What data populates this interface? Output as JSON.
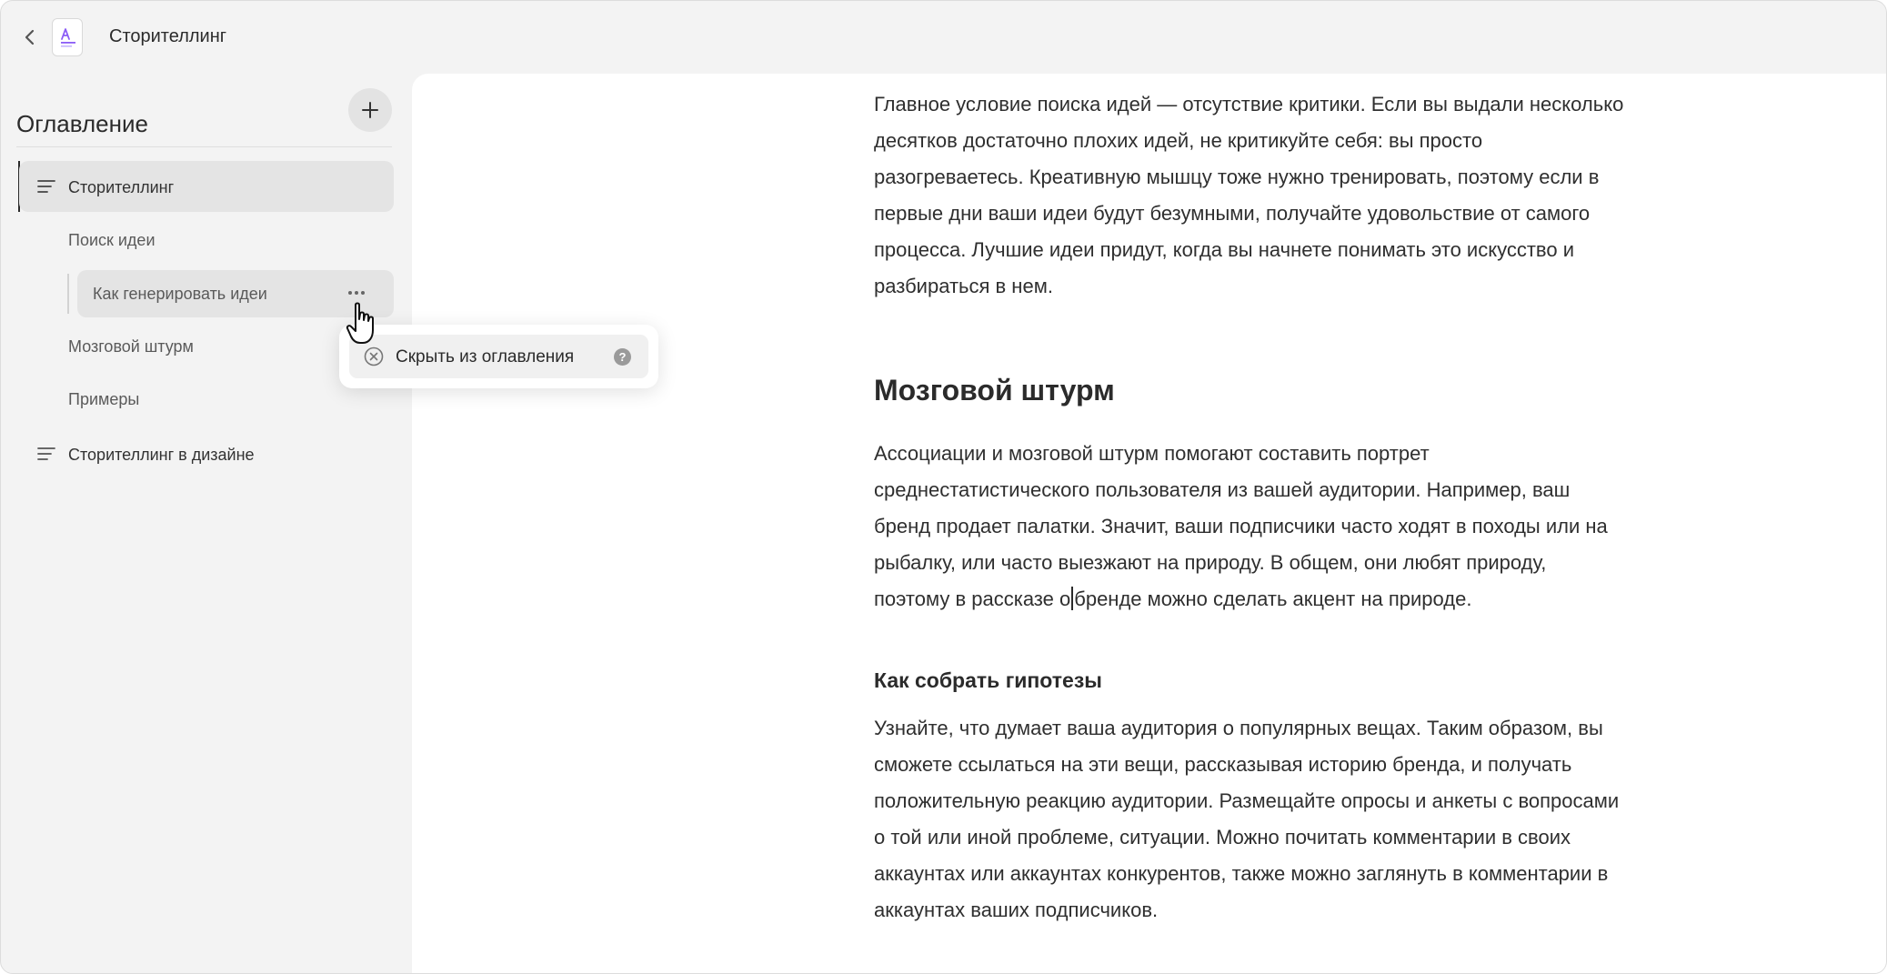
{
  "window": {
    "title": "Сторителлинг"
  },
  "sidebar": {
    "heading": "Оглавление",
    "add_button": "+",
    "items": [
      {
        "label": "Сторителлинг",
        "level": 1,
        "active": true
      },
      {
        "label": "Поиск идеи",
        "level": 2
      },
      {
        "label": "Как генерировать идеи",
        "level": 3,
        "hovered": true
      },
      {
        "label": "Мозговой штурм",
        "level": 2
      },
      {
        "label": "Примеры",
        "level": 2
      },
      {
        "label": "Сторителлинг в дизайне",
        "level": 1
      }
    ]
  },
  "context_menu": {
    "item_label": "Скрыть из оглавления",
    "help_icon": "?"
  },
  "article": {
    "intro_lines": [
      "Главное условие поиска идей — отсутствие критики. Если вы выдали несколько",
      "десятков достаточно плохих идей, не критикуйте себя: вы просто",
      "разогреваетесь. Креативную мышцу тоже нужно тренировать, поэтому если в",
      "первые дни ваши идеи будут безумными, получайте удовольствие от самого",
      "процесса. Лучшие идеи придут, когда вы начнете понимать это искусство и",
      "разбираться в нем."
    ],
    "h2": "Мозговой штурм",
    "brainstorm_lines": [
      "Ассоциации и мозговой штурм помогают составить портрет",
      "среднестатистического пользователя из вашей аудитории. Например, ваш",
      "бренд продает палатки. Значит, ваши подписчики часто ходят в походы или на",
      "рыбалку, или часто выезжают на природу. В общем, они любят природу,"
    ],
    "brainstorm_last_before_caret": "поэтому в рассказе о",
    "brainstorm_last_after_caret": "бренде можно сделать акцент на природе.",
    "h3": "Как собрать гипотезы",
    "hypotheses_lines": [
      "Узнайте, что думает ваша аудитория о популярных вещах. Таким образом, вы",
      "сможете ссылаться на эти вещи, рассказывая историю бренда, и получать",
      "положительную реакцию аудитории. Размещайте опросы и анкеты с вопросами",
      "о той или иной проблеме, ситуации. Можно почитать комментарии в своих",
      "аккаунтах или аккаунтах конкурентов, также можно заглянуть в комментарии в",
      "аккаунтах ваших подписчиков."
    ]
  },
  "colors": {
    "accent": "#8b5cf6",
    "panel": "#f3f3f3",
    "highlight": "#e4e4e4"
  }
}
